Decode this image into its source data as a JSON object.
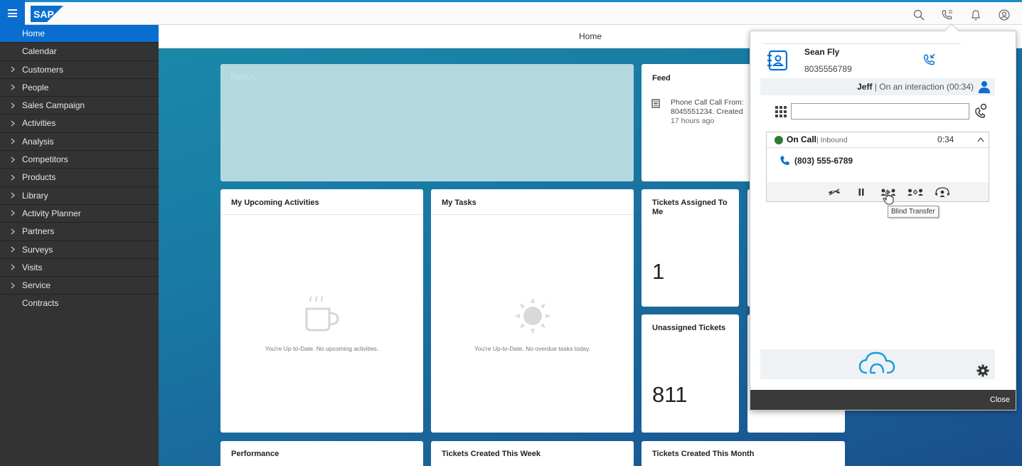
{
  "shell": {
    "logo_text": "SAP",
    "accent_color": "#0a6ed1",
    "top_icons": [
      "search-icon",
      "phone-icon",
      "bell-icon",
      "user-icon"
    ]
  },
  "sidebar": {
    "items": [
      {
        "label": "Home",
        "has_children": false,
        "active": true
      },
      {
        "label": "Calendar",
        "has_children": false
      },
      {
        "label": "Customers",
        "has_children": true
      },
      {
        "label": "People",
        "has_children": true
      },
      {
        "label": "Sales Campaign",
        "has_children": true
      },
      {
        "label": "Activities",
        "has_children": true
      },
      {
        "label": "Analysis",
        "has_children": true
      },
      {
        "label": "Competitors",
        "has_children": true
      },
      {
        "label": "Products",
        "has_children": true
      },
      {
        "label": "Library",
        "has_children": true
      },
      {
        "label": "Activity Planner",
        "has_children": true
      },
      {
        "label": "Partners",
        "has_children": true
      },
      {
        "label": "Surveys",
        "has_children": true
      },
      {
        "label": "Visits",
        "has_children": true
      },
      {
        "label": "Service",
        "has_children": true
      },
      {
        "label": "Contracts",
        "has_children": false
      }
    ]
  },
  "main": {
    "header_title": "Home",
    "news": {
      "title": "News"
    },
    "feed": {
      "title": "Feed",
      "item_text": "Phone Call Call From: 8045551234. Created",
      "item_time": "17 hours ago"
    },
    "upcoming": {
      "title": "My Upcoming Activities",
      "empty_text": "You're Up-to-Date. No upcoming activities."
    },
    "tasks": {
      "title": "My Tasks",
      "empty_text": "You're Up-to-Date. No overdue tasks today."
    },
    "tickets_assigned": {
      "title": "Tickets Assigned To Me",
      "count": "1"
    },
    "unassigned": {
      "title": "Unassigned Tickets",
      "count": "811"
    },
    "performance": {
      "title": "Performance"
    },
    "tickets_week": {
      "title": "Tickets Created This Week"
    },
    "tickets_month": {
      "title": "Tickets Created This Month"
    }
  },
  "phone_popup": {
    "contact_name": "Sean Fly",
    "contact_phone": "8035556789",
    "agent_name": "Jeff",
    "agent_status": "| On an interaction (00:34)",
    "dial_value": "",
    "call": {
      "state": "On Call",
      "direction": "| Inbound",
      "timer": "0:34",
      "number": "(803) 555-6789"
    },
    "tooltip": "Blind Transfer",
    "close_label": "Close",
    "status_color": "#2f7d32"
  }
}
